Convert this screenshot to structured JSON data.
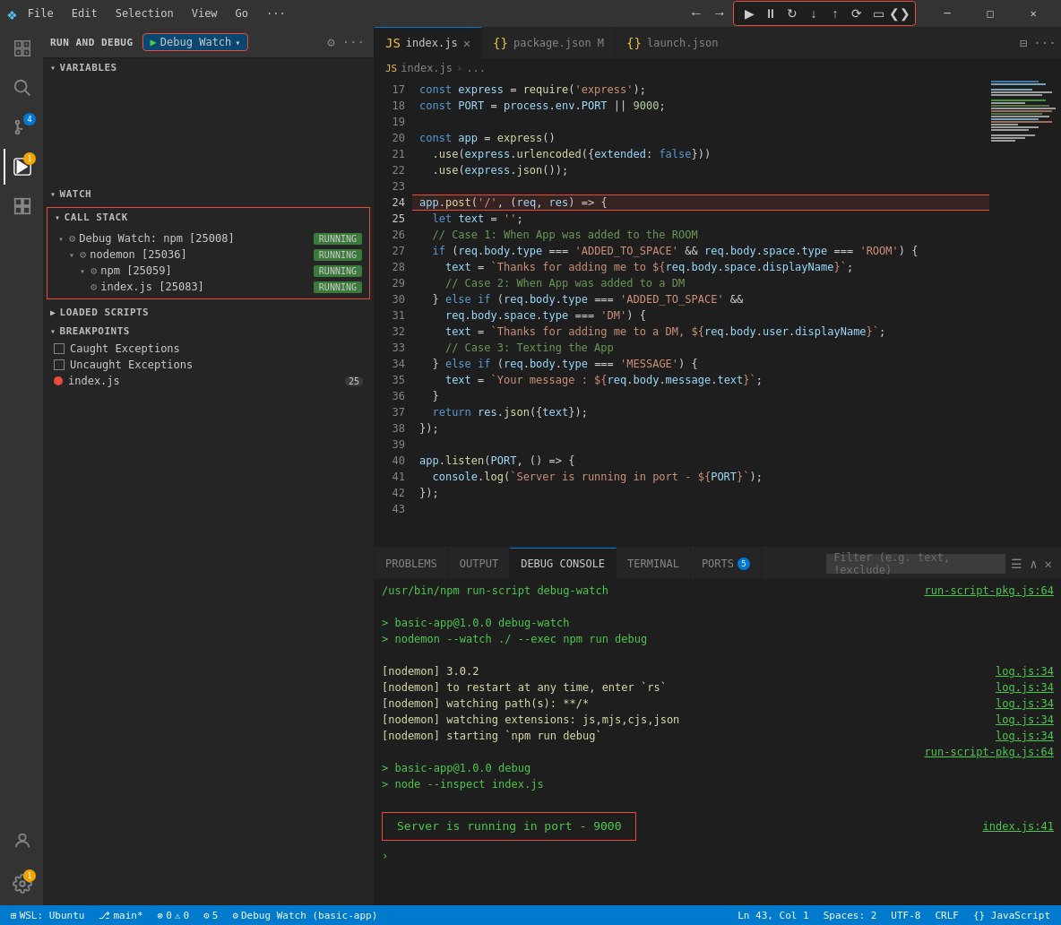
{
  "menubar": {
    "app_icon": "❖",
    "menus": [
      "File",
      "Edit",
      "Selection",
      "View",
      "Go",
      "···"
    ],
    "debug_controls": [
      "⟵",
      "▶",
      "⏸",
      "🔄",
      "⬇",
      "⬆",
      "⟳",
      "▭",
      "❮❯"
    ],
    "window_controls": [
      "─",
      "□",
      "✕"
    ]
  },
  "sidebar": {
    "run_label": "RUN AND DEBUG",
    "debug_config": "Debug Watch",
    "sections": {
      "variables": "VARIABLES",
      "watch": "WATCH",
      "call_stack": "CALL STACK",
      "loaded_scripts": "LOADED SCRIPTS",
      "breakpoints": "BREAKPOINTS"
    },
    "call_stack_items": [
      {
        "name": "Debug Watch: npm [25008]",
        "status": "RUNNING",
        "level": 0
      },
      {
        "name": "nodemon [25036]",
        "status": "RUNNING",
        "level": 1
      },
      {
        "name": "npm [25059]",
        "status": "RUNNING",
        "level": 2
      },
      {
        "name": "index.js [25083]",
        "status": "RUNNING",
        "level": 3
      }
    ],
    "breakpoints": [
      {
        "type": "checkbox",
        "label": "Caught Exceptions",
        "checked": false
      },
      {
        "type": "checkbox",
        "label": "Uncaught Exceptions",
        "checked": false
      },
      {
        "type": "dot",
        "label": "index.js",
        "badge": "25"
      }
    ]
  },
  "editor": {
    "tabs": [
      {
        "id": "index",
        "icon": "JS",
        "label": "index.js",
        "active": true,
        "modified": false
      },
      {
        "id": "package",
        "icon": "{}",
        "label": "package.json M",
        "active": false,
        "modified": true
      },
      {
        "id": "launch",
        "icon": "{}",
        "label": "launch.json",
        "active": false,
        "modified": false
      }
    ],
    "breadcrumb": [
      "JS index.js",
      ">",
      "..."
    ],
    "lines": [
      {
        "num": 17,
        "code": "const express = require('express');"
      },
      {
        "num": 18,
        "code": "const PORT = process.env.PORT || 9000;"
      },
      {
        "num": 19,
        "code": ""
      },
      {
        "num": 20,
        "code": "const app = express()"
      },
      {
        "num": 21,
        "code": "  .use(express.urlencoded({extended: false}))"
      },
      {
        "num": 22,
        "code": "  .use(express.json());"
      },
      {
        "num": 23,
        "code": ""
      },
      {
        "num": 24,
        "code": "app.post('/', (req, res) => {",
        "highlight": true
      },
      {
        "num": 25,
        "code": "  let text = '';",
        "breakpoint": true
      },
      {
        "num": 26,
        "code": "  // Case 1: When App was added to the ROOM"
      },
      {
        "num": 27,
        "code": "  if (req.body.type === 'ADDED_TO_SPACE' && req.body.space.type === 'ROOM') {"
      },
      {
        "num": 28,
        "code": "    text = `Thanks for adding me to ${req.body.space.displayName}`;"
      },
      {
        "num": 29,
        "code": "    // Case 2: When App was added to a DM"
      },
      {
        "num": 30,
        "code": "  } else if (req.body.type === 'ADDED_TO_SPACE' &&"
      },
      {
        "num": 31,
        "code": "    req.body.space.type === 'DM') {"
      },
      {
        "num": 32,
        "code": "    text = `Thanks for adding me to a DM, ${req.body.user.displayName}`;"
      },
      {
        "num": 33,
        "code": "    // Case 3: Texting the App"
      },
      {
        "num": 34,
        "code": "  } else if (req.body.type === 'MESSAGE') {"
      },
      {
        "num": 35,
        "code": "    text = `Your message : ${req.body.message.text}`;"
      },
      {
        "num": 36,
        "code": "  }"
      },
      {
        "num": 37,
        "code": "  return res.json({text});"
      },
      {
        "num": 38,
        "code": "});"
      },
      {
        "num": 39,
        "code": ""
      },
      {
        "num": 40,
        "code": "app.listen(PORT, () => {"
      },
      {
        "num": 41,
        "code": "  console.log(`Server is running in port - ${PORT}`);"
      },
      {
        "num": 42,
        "code": "});"
      },
      {
        "num": 43,
        "code": ""
      }
    ]
  },
  "bottom_panel": {
    "tabs": [
      {
        "label": "PROBLEMS",
        "active": false
      },
      {
        "label": "OUTPUT",
        "active": false
      },
      {
        "label": "DEBUG CONSOLE",
        "active": true
      },
      {
        "label": "TERMINAL",
        "active": false
      },
      {
        "label": "PORTS",
        "active": false,
        "badge": "5"
      }
    ],
    "filter_placeholder": "Filter (e.g. text, !exclude)",
    "console_lines": [
      {
        "text": "/usr/bin/npm run-script debug-watch",
        "color": "green",
        "link": "run-script-pkg.js:64"
      },
      {
        "text": ""
      },
      {
        "text": "> basic-app@1.0.0 debug-watch",
        "color": "green"
      },
      {
        "text": "> nodemon --watch ./ --exec npm run debug",
        "color": "green"
      },
      {
        "text": ""
      },
      {
        "text": "[nodemon] 3.0.2",
        "color": "yellow"
      },
      {
        "text": "[nodemon] to restart at any time, enter `rs`",
        "color": "yellow",
        "link": "log.js:34"
      },
      {
        "text": "[nodemon] watching path(s): **/*",
        "color": "yellow",
        "link": "log.js:34"
      },
      {
        "text": "[nodemon] watching extensions: js,mjs,cjs,json",
        "color": "yellow",
        "link": "log.js:34"
      },
      {
        "text": "[nodemon] starting `npm run debug`",
        "color": "yellow",
        "link": "log.js:34"
      },
      {
        "text": "",
        "link": "run-script-pkg.js:64"
      },
      {
        "text": "> basic-app@1.0.0 debug",
        "color": "green"
      },
      {
        "text": "> node --inspect index.js",
        "color": "green"
      },
      {
        "text": ""
      },
      {
        "text": "Server is running in port - 9000",
        "color": "green",
        "box": true,
        "link": "index.js:41"
      }
    ]
  },
  "status_bar": {
    "wsl": "WSL: Ubuntu",
    "branch": "main*",
    "info": "⚠ 0 ⊗ 0",
    "debug": "⚙ 5",
    "config": "Debug Watch (basic-app)",
    "position": "Ln 43, Col 1",
    "spaces": "Spaces: 2",
    "encoding": "UTF-8",
    "eol": "CRLF",
    "language": "{} JavaScript"
  }
}
